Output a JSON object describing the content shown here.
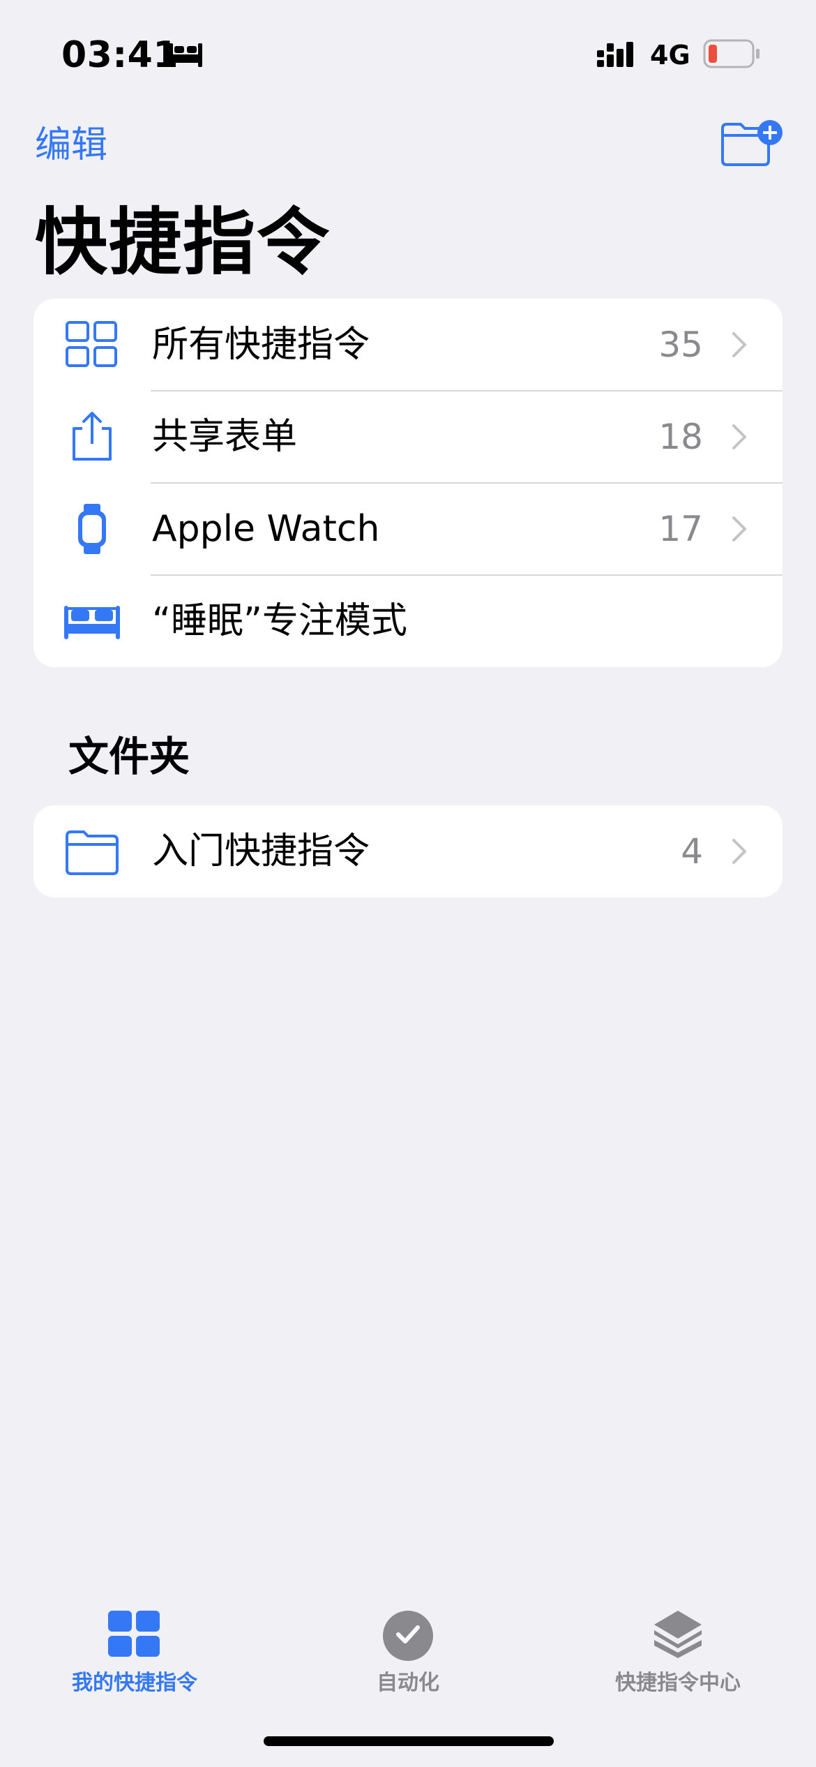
{
  "status_bar": {
    "time": "03:41",
    "focus_icon": "bed-icon",
    "network": "4G",
    "battery_color": "#eb4e3d"
  },
  "nav": {
    "edit_label": "编辑",
    "new_folder_icon": "folder-plus-icon",
    "title": "快捷指令"
  },
  "shortcuts": {
    "items": [
      {
        "icon": "grid-icon",
        "label": "所有快捷指令",
        "count": "35"
      },
      {
        "icon": "share-icon",
        "label": "共享表单",
        "count": "18"
      },
      {
        "icon": "watch-icon",
        "label": "Apple Watch",
        "count": "17"
      },
      {
        "icon": "bed-icon",
        "label": "“睡眠”专注模式",
        "count": ""
      }
    ]
  },
  "folders": {
    "section_title": "文件夹",
    "items": [
      {
        "icon": "folder-icon",
        "label": "入门快捷指令",
        "count": "4"
      }
    ]
  },
  "tab_bar": {
    "tabs": [
      {
        "icon": "grid-icon",
        "label": "我的快捷指令",
        "active": true
      },
      {
        "icon": "checkmark-circle-icon",
        "label": "自动化",
        "active": false
      },
      {
        "icon": "layers-icon",
        "label": "快捷指令中心",
        "active": false
      }
    ]
  },
  "colors": {
    "accent": "#3478f6",
    "background": "#f0f0f5",
    "secondary_text": "#8a8a8e"
  }
}
